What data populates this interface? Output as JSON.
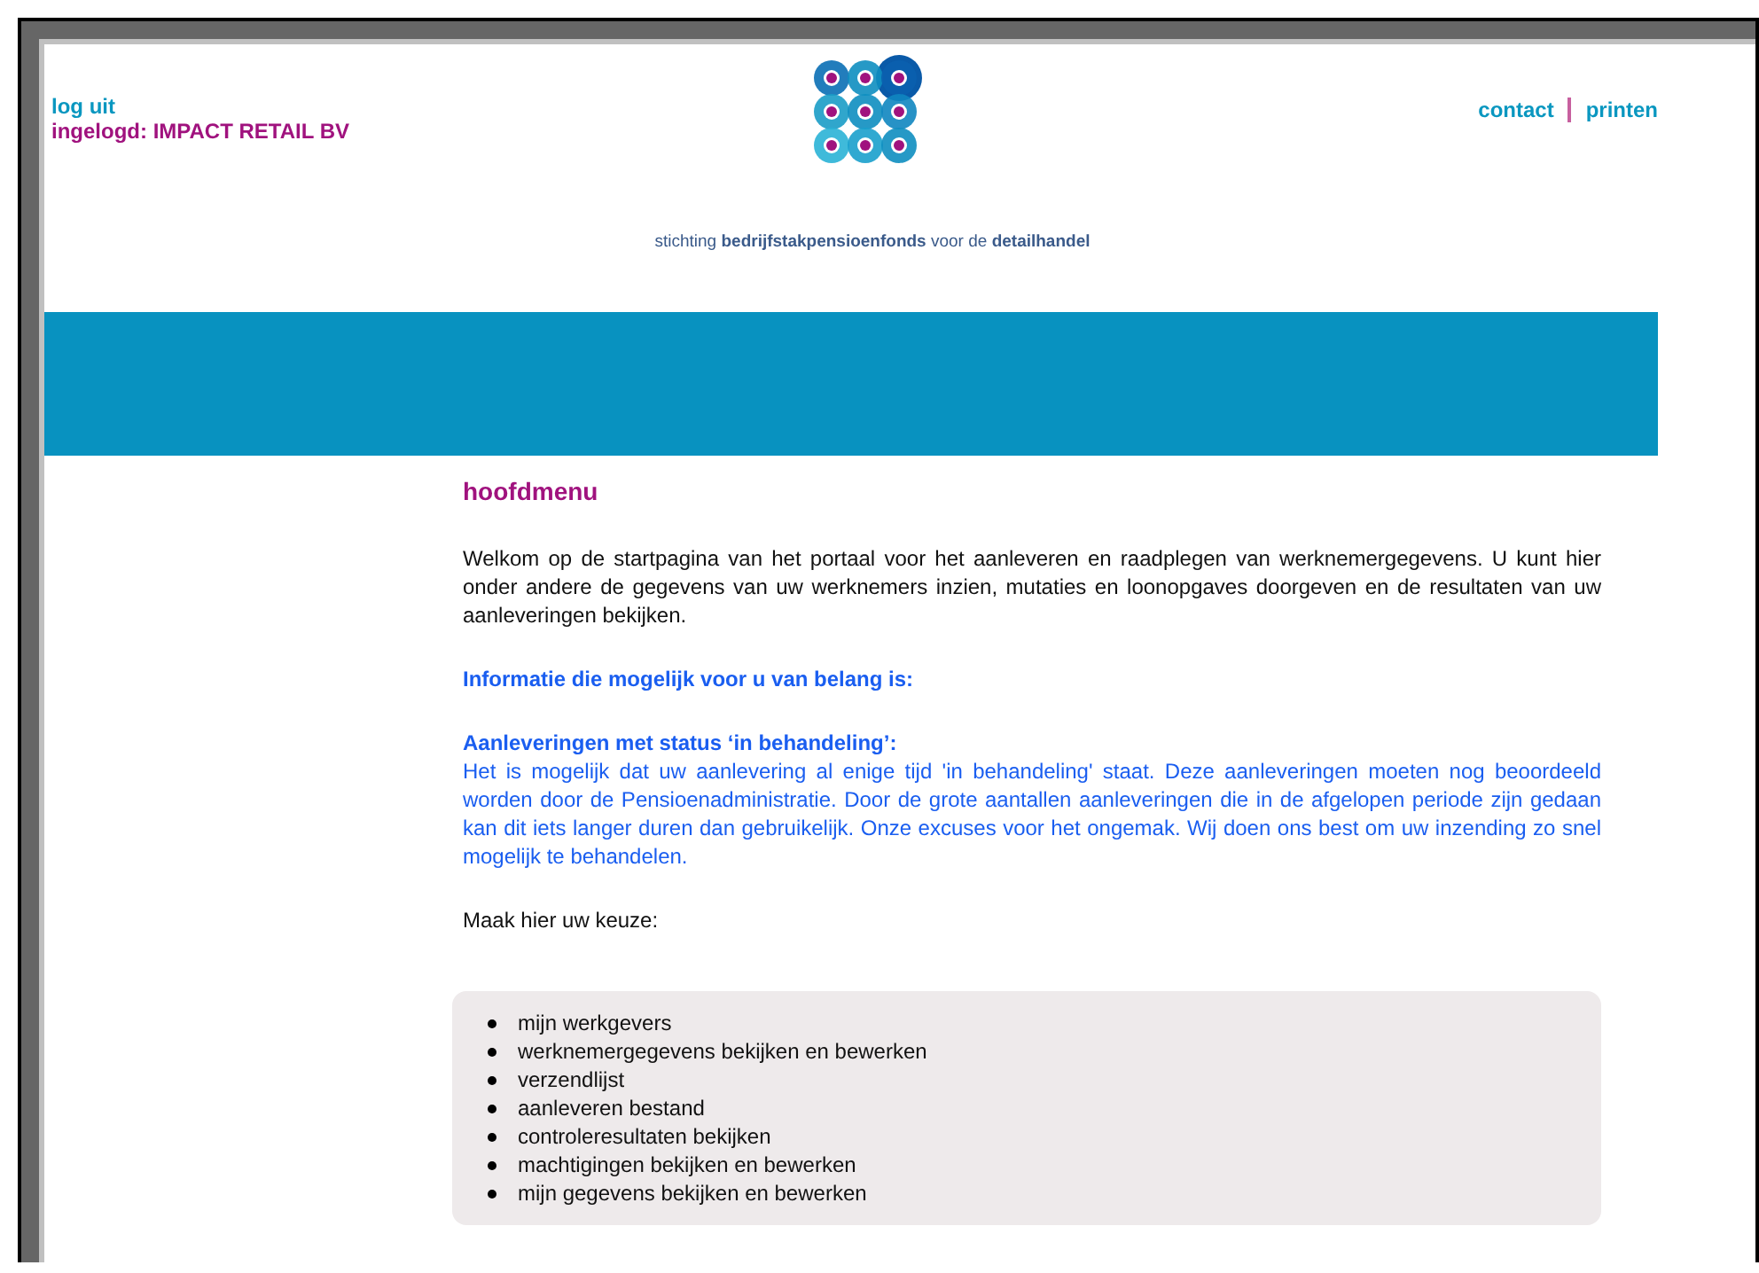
{
  "header": {
    "logout": "log uit",
    "logged_in": "ingelogd: IMPACT RETAIL BV",
    "tagline": "stichting **bedrijfstakpensioenfonds** voor de **detailhandel**",
    "links": [
      "contact",
      "printen"
    ]
  },
  "main": {
    "title": "hoofdmenu",
    "intro": "Welkom op de startpagina van het portaal voor het aanleveren en raadplegen van werknemergegevens. U kunt hier onder andere de gegevens van uw werknemers inzien, mutaties en loonopgaves doorgeven en de resultaten van uw aanleveringen bekijken.",
    "info_heading": "Informatie die mogelijk voor u van belang is:",
    "notice_heading": "Aanleveringen met status ‘in behandeling’:",
    "notice_text": "Het is mogelijk dat uw aanlevering al enige tijd 'in behandeling' staat. Deze aanleveringen moeten nog beoordeeld worden door de Pensioenadministratie. Door de grote aantallen aanleveringen die in de afgelopen periode zijn gedaan kan dit iets langer duren dan gebruikelijk. Onze excuses voor het ongemak. Wij doen ons best om uw inzending zo snel mogelijk te behandelen.",
    "choose": "Maak hier uw keuze:",
    "menu": [
      "mijn werkgevers",
      "werknemergegevens bekijken en bewerken",
      "verzendlijst",
      "aanleveren bestand",
      "controleresultaten bekijken",
      "machtigingen bekijken en bewerken",
      "mijn gegevens bekijken en bewerken"
    ]
  }
}
